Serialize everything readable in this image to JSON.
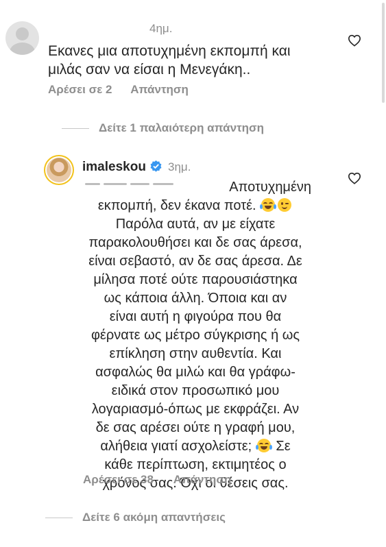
{
  "comment1": {
    "time": "4ημ.",
    "text": "Εκανες μια αποτυχημένη εκπομπή και μιλάς σαν να είσαι η Μενεγάκη..",
    "likes_label": "Αρέσει σε 2",
    "reply_label": "Απάντηση",
    "like_icon": "heart-outline-icon"
  },
  "view_older_replies": "Δείτε 1 παλαιότερη απάντηση",
  "reply": {
    "username": "imaleskou",
    "verified_icon": "verified-badge-icon",
    "verified_color": "#3897f0",
    "time": "3ημ.",
    "lines": [
      "Αποτυχημένη",
      "εκπομπή, δεν έκανα ποτέ.",
      "Παρόλα αυτά, αν με είχατε",
      "παρακολουθήσει και δε σας άρεσα,",
      "είναι σεβαστό, αν δε σας άρεσα. Δε",
      "μίλησα ποτέ ούτε παρουσιάστηκα",
      "ως κάποια άλλη.  Όποια και αν",
      "είναι αυτή η φιγούρα που θα",
      "φέρνατε ως μέτρο σύγκρισης ή ως",
      "επίκληση στην αυθεντία. Και",
      "ασφαλώς θα μιλώ και θα γράφω-",
      "ειδικά στον προσωπικό μου",
      "λογαριασμό-όπως με εκφράζει. Αν",
      "δε σας αρέσει ούτε η γραφή μου,",
      "αλήθεια γιατί ασχολείστε;",
      "Σε",
      "κάθε περίπτωση, εκτιμητέος ο",
      "χρόνος σας. Όχι οι θέσεις σας."
    ],
    "likes_label": "Αρέσει σε 38",
    "reply_label": "Απάντηση",
    "like_icon": "heart-outline-icon"
  },
  "view_more_replies": "Δείτε 6 ακόμη απαντήσεις"
}
